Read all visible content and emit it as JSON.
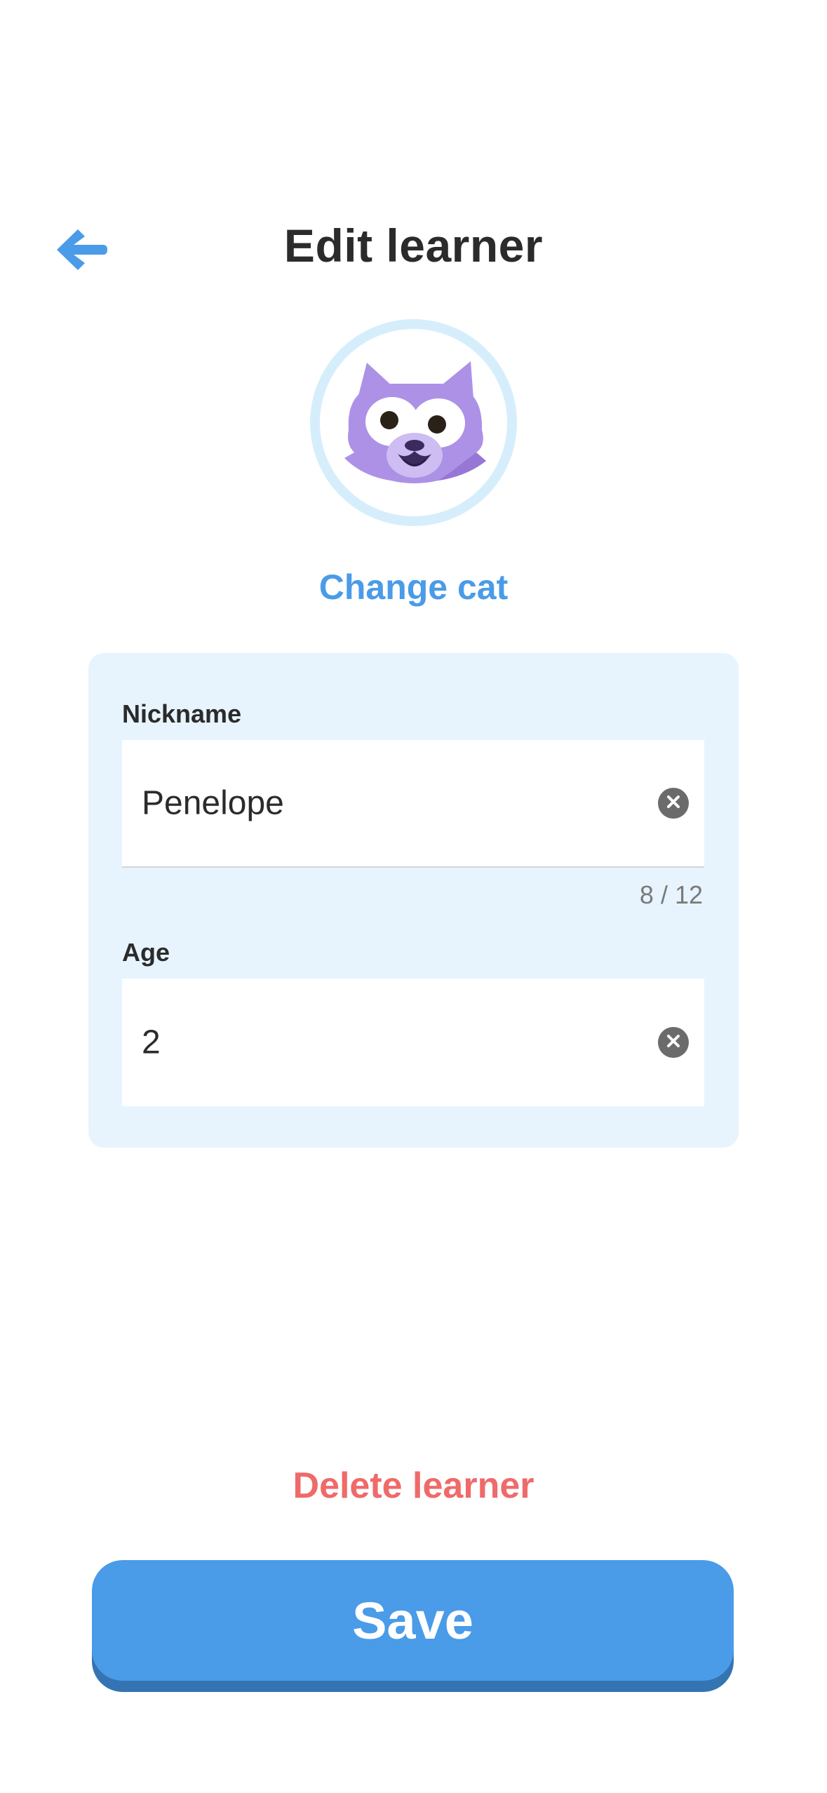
{
  "header": {
    "title": "Edit learner",
    "back_icon": "arrow-left-icon"
  },
  "avatar": {
    "icon": "purple-cat-face-icon",
    "ring_color": "#d6eefc",
    "change_label": "Change cat"
  },
  "form": {
    "nickname": {
      "label": "Nickname",
      "value": "Penelope",
      "counter": "8 / 12",
      "clear_icon": "clear-circle-icon"
    },
    "age": {
      "label": "Age",
      "value": "2",
      "clear_icon": "clear-circle-icon"
    }
  },
  "actions": {
    "delete_label": "Delete learner",
    "save_label": "Save"
  },
  "colors": {
    "accent": "#4a9be8",
    "danger": "#ef6a6a",
    "card_bg": "#e7f4fd",
    "cat": "#ad91e6"
  }
}
